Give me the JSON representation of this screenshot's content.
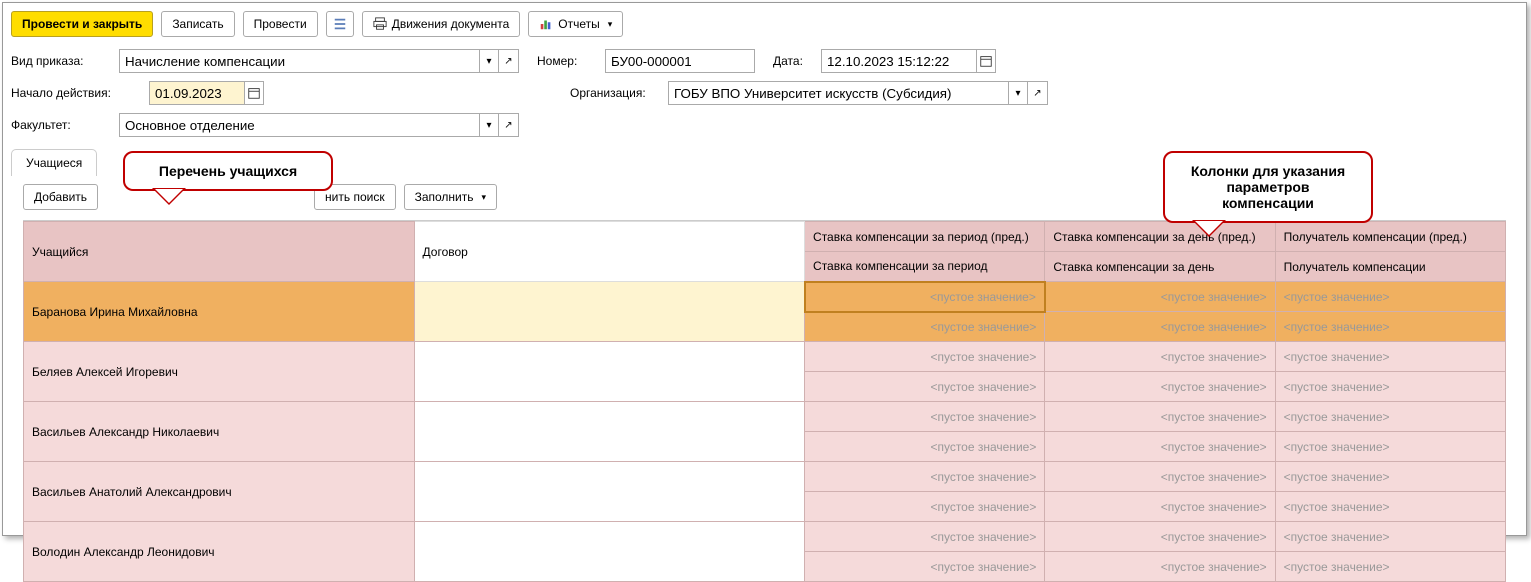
{
  "toolbar": {
    "post_close": "Провести и закрыть",
    "save": "Записать",
    "post": "Провести",
    "movements": "Движения документа",
    "reports": "Отчеты"
  },
  "form": {
    "order_type_label": "Вид приказа:",
    "order_type_value": "Начисление компенсации",
    "number_label": "Номер:",
    "number_value": "БУ00-000001",
    "date_label": "Дата:",
    "date_value": "12.10.2023 15:12:22",
    "start_label": "Начало действия:",
    "start_value": "01.09.2023",
    "org_label": "Организация:",
    "org_value": "ГОБУ ВПО Университет искусств (Субсидия)",
    "faculty_label": "Факультет:",
    "faculty_value": "Основное отделение"
  },
  "tabs": {
    "students": "Учащиеся"
  },
  "subtoolbar": {
    "add": "Добавить",
    "cancel_search": "нить поиск",
    "fill": "Заполнить"
  },
  "table": {
    "headers": {
      "student": "Учащийся",
      "contract": "Договор",
      "rate_period_prev": "Ставка компенсации за период (пред.)",
      "rate_period": "Ставка компенсации за период",
      "rate_day_prev": "Ставка компенсации за день (пред.)",
      "rate_day": "Ставка компенсации за день",
      "recipient_prev": "Получатель компенсации (пред.)",
      "recipient": "Получатель компенсации"
    },
    "empty": "<пустое значение>",
    "rows": [
      {
        "name": "Баранова Ирина Михайловна",
        "selected": true
      },
      {
        "name": "Беляев Алексей Игоревич"
      },
      {
        "name": "Васильев Александр Николаевич"
      },
      {
        "name": "Васильев Анатолий Александрович"
      },
      {
        "name": "Володин Александр Леонидович"
      }
    ]
  },
  "callouts": {
    "c1": "Перечень учащихся",
    "c2": "Колонки для указания параметров компенсации"
  }
}
